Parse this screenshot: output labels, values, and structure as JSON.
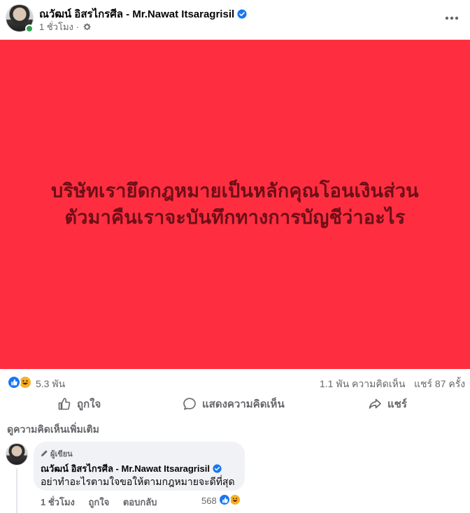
{
  "post": {
    "author": "ณวัฒน์ อิสรไกรศีล - Mr.Nawat Itsaragrisil",
    "time": "1 ชั่วโมง",
    "separator": "·",
    "text_lines": [
      "บริษัทเรายึดกฎหมายเป็นหลักคุณโอนเงินส่วน",
      "ตัวมาคืนเราจะบันทึกทางการบัญชีว่าอะไร"
    ],
    "background_color": "#fe2e40",
    "text_color": "#6b0f17"
  },
  "stats": {
    "reactions": "5.3 พัน",
    "comments": "1.1 พัน ความคิดเห็น",
    "shares": "แชร์ 87 ครั้ง"
  },
  "actions": {
    "like": "ถูกใจ",
    "comment": "แสดงความคิดเห็น",
    "share": "แชร์"
  },
  "more_comments": "ดูความคิดเห็นเพิ่มเติม",
  "comment": {
    "badge": "ผู้เขียน",
    "author": "ณวัฒน์ อิสรไกรศีล - Mr.Nawat Itsaragrisil",
    "text": "อย่าทำอะไรตามใจขอให้ตามกฎหมายจะดีที่สุด",
    "time": "1 ชั่วโมง",
    "like": "ถูกใจ",
    "reply": "ตอบกลับ",
    "reaction_count": "568"
  },
  "icons": {
    "verified": "verified-badge-icon",
    "audience": "gear-icon",
    "more": "more-dots-icon",
    "like": "thumbs-up-icon",
    "comment": "speech-bubble-icon",
    "share": "share-arrow-icon"
  },
  "colors": {
    "accent": "#1877f2",
    "secondary_text": "#65676b",
    "online": "#31a24c",
    "haha": "#f7b125"
  }
}
